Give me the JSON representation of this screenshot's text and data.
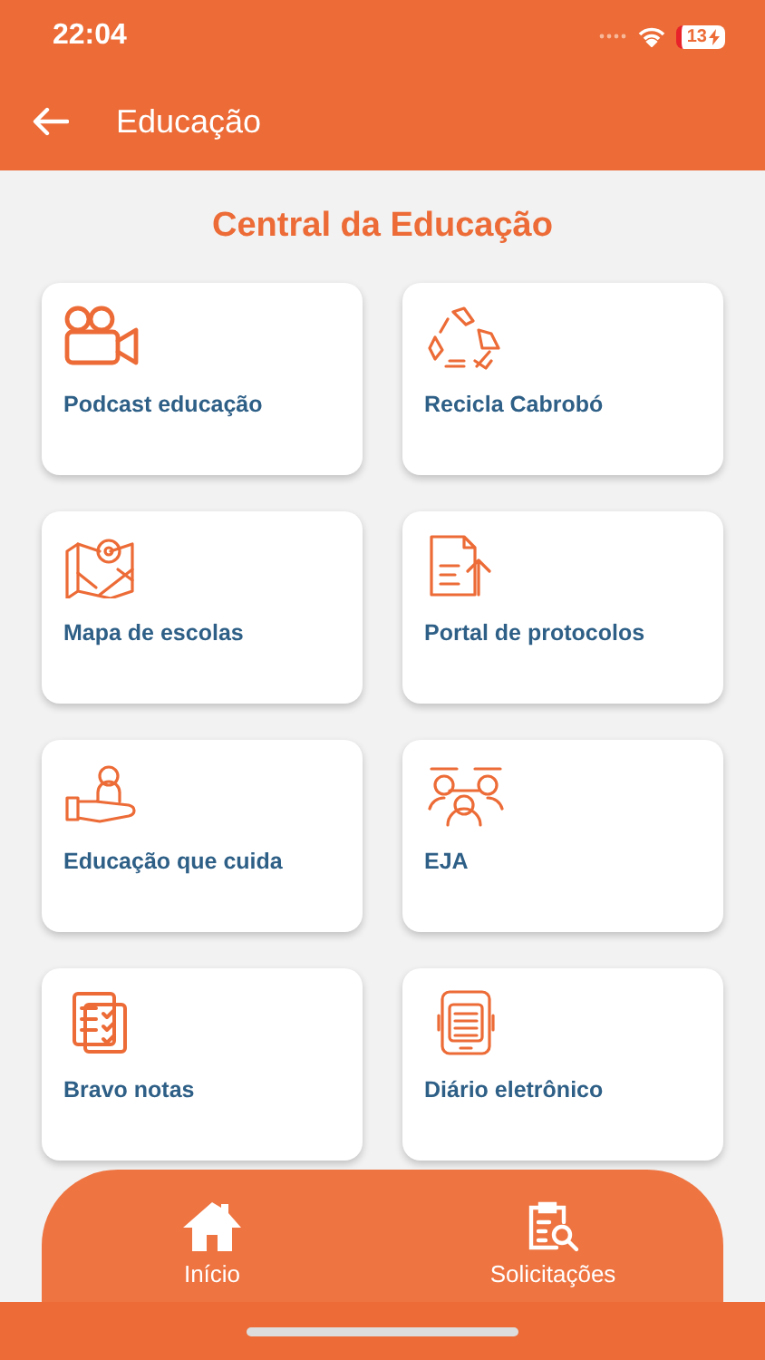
{
  "status_bar": {
    "time": "22:04",
    "battery": "13"
  },
  "header": {
    "title": "Educação"
  },
  "section_title": "Central da Educação",
  "tiles": [
    {
      "label": "Podcast educação"
    },
    {
      "label": "Recicla Cabrobó"
    },
    {
      "label": "Mapa de escolas"
    },
    {
      "label": "Portal de protocolos"
    },
    {
      "label": "Educação que cuida"
    },
    {
      "label": "EJA"
    },
    {
      "label": "Bravo notas"
    },
    {
      "label": "Diário eletrônico"
    }
  ],
  "bottom_nav": [
    {
      "label": "Início"
    },
    {
      "label": "Solicitações"
    }
  ]
}
